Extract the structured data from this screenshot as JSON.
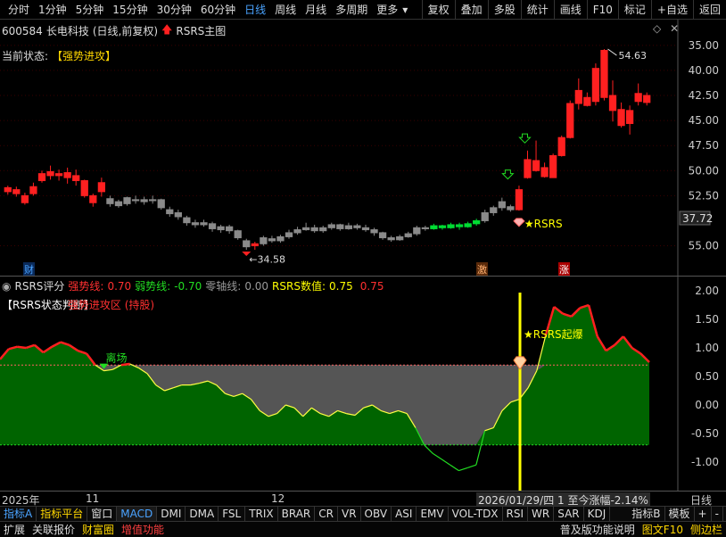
{
  "toolbar": {
    "periods": [
      "分时",
      "1分钟",
      "5分钟",
      "15分钟",
      "30分钟",
      "60分钟",
      "日线",
      "周线",
      "月线",
      "多周期",
      "更多"
    ],
    "active_period": "日线",
    "right_items": [
      "复权",
      "叠加",
      "多股",
      "统计",
      "画线",
      "F10",
      "标记",
      "+自选",
      "返回"
    ]
  },
  "main": {
    "code": "600584",
    "name": "长电科技",
    "mode": "(日线,前复权)",
    "indicator": "RSRS主图",
    "status_label": "当前状态:",
    "status_value": "【强势进攻】",
    "high_label": "54.63",
    "low_label": "34.58",
    "last_price": "37.72",
    "rsrs_tag": "RSRS",
    "markers": [
      "财",
      "激",
      "涨"
    ],
    "y_ticks": [
      "55.00",
      "52.50",
      "50.00",
      "47.50",
      "45.00",
      "42.50",
      "40.00",
      "35.00"
    ]
  },
  "indicator": {
    "name": "RSRS评分",
    "strong_label": "强势线:",
    "strong_value": "0.70",
    "weak_label": "弱势线:",
    "weak_value": "-0.70",
    "zero_label": "零轴线:",
    "zero_value": "0.00",
    "rsrs_label": "RSRS数值:",
    "rsrs_value": "0.75",
    "extra_value": "0.75",
    "state_title": "【RSRS状态判断】",
    "state_value": "强势进攻区 (持股)",
    "exit_label": "离场",
    "burst_label": "RSRS起爆",
    "y_ticks": [
      "2.00",
      "1.50",
      "1.00",
      "0.50",
      "0.00",
      "-0.50",
      "-1.00"
    ]
  },
  "dates": {
    "year": "2025年",
    "m11": "11",
    "m12": "12",
    "cursor_info": "2026/01/29/四 1 至今涨幅-2.14%",
    "period": "日线"
  },
  "tabs": [
    "指标A",
    "指标平台",
    "窗口",
    "MACD",
    "DMI",
    "DMA",
    "FSL",
    "TRIX",
    "BRAR",
    "CR",
    "VR",
    "OBV",
    "ASI",
    "EMV",
    "VOL-TDX",
    "RSI",
    "WR",
    "SAR",
    "KDJ",
    "指标B",
    "模板",
    "+",
    "-"
  ],
  "statusbar": {
    "left": [
      "扩展",
      "关联报价",
      "财富圈",
      "增值功能"
    ],
    "right": [
      "普及版功能说明",
      "图文F10",
      "侧边栏"
    ]
  },
  "colors": {
    "up": "#ff2020",
    "down": "#00cc44",
    "neutral": "#888888",
    "fill_green": "#006400",
    "yellow": "#ffff00",
    "accent_blue": "#4aa3ff"
  },
  "chart_data": [
    {
      "type": "candlestick",
      "title": "RSRS主图",
      "ylim": [
        33,
        56.5
      ],
      "y_ticks": [
        35,
        40,
        42.5,
        45,
        47.5,
        50,
        52.5,
        55
      ],
      "candles": [
        [
          40.8,
          40.4,
          41.0,
          40.1,
          "r"
        ],
        [
          40.2,
          40.6,
          40.9,
          39.9,
          "r"
        ],
        [
          40.0,
          39.3,
          40.3,
          39.1,
          "r"
        ],
        [
          40.2,
          40.9,
          41.3,
          40.0,
          "r"
        ],
        [
          41.5,
          42.2,
          42.5,
          41.3,
          "r"
        ],
        [
          42.4,
          42.0,
          43.0,
          41.6,
          "r"
        ],
        [
          42.0,
          42.2,
          42.6,
          41.5,
          "r"
        ],
        [
          41.8,
          42.3,
          42.8,
          41.2,
          "r"
        ],
        [
          42.0,
          41.5,
          42.6,
          41.0,
          "r"
        ],
        [
          41.5,
          40.0,
          41.6,
          39.8,
          "r"
        ],
        [
          40.0,
          39.3,
          40.2,
          38.9,
          "r"
        ],
        [
          40.4,
          41.3,
          41.8,
          39.9,
          "r"
        ],
        [
          39.2,
          39.7,
          40.0,
          38.9,
          "g"
        ],
        [
          39.0,
          39.4,
          39.6,
          38.8,
          "g"
        ],
        [
          39.2,
          39.8,
          39.9,
          39.0,
          "g"
        ],
        [
          39.5,
          39.6,
          40.0,
          39.2,
          "g"
        ],
        [
          39.6,
          39.4,
          39.9,
          39.1,
          "g"
        ],
        [
          39.5,
          39.6,
          40.0,
          39.2,
          "g"
        ],
        [
          39.6,
          38.8,
          39.7,
          38.6,
          "g"
        ],
        [
          38.6,
          38.2,
          38.9,
          37.9,
          "g"
        ],
        [
          38.3,
          37.9,
          38.6,
          37.6,
          "g"
        ],
        [
          37.8,
          37.3,
          38.0,
          37.0,
          "g"
        ],
        [
          37.3,
          37.1,
          37.6,
          36.8,
          "g"
        ],
        [
          37.1,
          37.3,
          37.6,
          36.9,
          "g"
        ],
        [
          37.2,
          36.7,
          37.4,
          36.4,
          "g"
        ],
        [
          36.6,
          36.9,
          37.1,
          36.3,
          "g"
        ],
        [
          36.9,
          36.5,
          37.1,
          36.2,
          "g"
        ],
        [
          36.5,
          35.8,
          36.6,
          35.6,
          "g"
        ],
        [
          35.5,
          34.9,
          35.7,
          34.6,
          "g"
        ],
        [
          35.0,
          35.2,
          35.4,
          34.6,
          "r"
        ],
        [
          35.2,
          35.8,
          36.0,
          35.0,
          "g"
        ],
        [
          35.7,
          35.5,
          36.0,
          35.3,
          "g"
        ],
        [
          35.5,
          35.9,
          36.1,
          35.3,
          "g"
        ],
        [
          35.9,
          36.3,
          36.6,
          35.7,
          "g"
        ],
        [
          36.3,
          36.6,
          36.9,
          36.1,
          "g"
        ],
        [
          36.6,
          36.8,
          37.3,
          36.5,
          "g"
        ],
        [
          36.8,
          36.5,
          37.1,
          36.3,
          "g"
        ],
        [
          36.5,
          36.8,
          37.0,
          36.3,
          "g"
        ],
        [
          36.8,
          37.1,
          37.3,
          36.6,
          "g"
        ],
        [
          37.1,
          36.7,
          37.2,
          36.5,
          "g"
        ],
        [
          36.7,
          37.0,
          37.3,
          36.6,
          "g"
        ],
        [
          37.0,
          36.8,
          37.2,
          36.6,
          "g"
        ],
        [
          36.8,
          36.6,
          37.1,
          36.4,
          "g"
        ],
        [
          36.6,
          36.3,
          36.8,
          36.0,
          "g"
        ],
        [
          36.3,
          35.8,
          36.4,
          35.6,
          "g"
        ],
        [
          35.8,
          35.6,
          36.0,
          35.4,
          "g"
        ],
        [
          35.6,
          35.9,
          36.1,
          35.5,
          "g"
        ],
        [
          35.9,
          36.2,
          36.4,
          35.8,
          "g"
        ],
        [
          36.2,
          36.8,
          37.0,
          36.0,
          "g"
        ],
        [
          36.8,
          36.7,
          37.0,
          36.5,
          "g"
        ],
        [
          36.7,
          37.0,
          37.2,
          36.6,
          "gg"
        ],
        [
          37.0,
          36.8,
          37.1,
          36.6,
          "gg"
        ],
        [
          36.8,
          37.1,
          37.3,
          36.7,
          "gg"
        ],
        [
          37.1,
          36.9,
          37.3,
          36.6,
          "gg"
        ],
        [
          36.9,
          37.2,
          37.4,
          36.8,
          "gg"
        ],
        [
          37.2,
          37.5,
          37.7,
          37.0,
          "gg"
        ],
        [
          37.5,
          38.3,
          38.6,
          37.3,
          "g"
        ],
        [
          38.3,
          38.8,
          39.0,
          38.0,
          "g"
        ],
        [
          38.8,
          39.4,
          39.8,
          38.5,
          "g"
        ],
        [
          38.9,
          38.6,
          39.1,
          38.4,
          "g"
        ],
        [
          38.6,
          40.6,
          41.0,
          38.5,
          "r"
        ],
        [
          41.8,
          43.6,
          44.5,
          41.7,
          "r"
        ],
        [
          42.5,
          43.5,
          45.5,
          42.4,
          "r"
        ],
        [
          42.8,
          41.9,
          43.3,
          41.8,
          "r"
        ],
        [
          41.8,
          44.0,
          44.2,
          41.8,
          "r"
        ],
        [
          44.0,
          45.8,
          46.0,
          43.9,
          "r"
        ],
        [
          45.8,
          49.2,
          49.5,
          45.7,
          "r"
        ],
        [
          49.2,
          50.5,
          51.7,
          48.6,
          "r"
        ],
        [
          49.0,
          49.8,
          50.3,
          48.9,
          "r"
        ],
        [
          49.4,
          52.7,
          53.2,
          49.0,
          "r"
        ],
        [
          49.8,
          54.5,
          54.63,
          49.5,
          "r"
        ],
        [
          50.0,
          48.5,
          51.5,
          47.4,
          "r"
        ],
        [
          48.6,
          47.0,
          49.3,
          46.8,
          "r"
        ],
        [
          47.2,
          48.5,
          49.0,
          46.1,
          "r"
        ],
        [
          49.4,
          50.2,
          51.2,
          49.0,
          "r"
        ],
        [
          50.0,
          49.3,
          50.3,
          49.0,
          "r"
        ]
      ]
    },
    {
      "type": "area",
      "title": "RSRS评分",
      "ylim": [
        -1.5,
        2.25
      ],
      "y_ticks": [
        -1.0,
        -0.5,
        0,
        0.5,
        1.0,
        1.5,
        2.0
      ],
      "strong_line": 0.7,
      "weak_line": -0.7,
      "values": [
        0.8,
        0.98,
        1.02,
        1.0,
        1.05,
        0.92,
        1.02,
        1.1,
        1.05,
        0.95,
        0.9,
        0.7,
        0.6,
        0.62,
        0.7,
        0.72,
        0.65,
        0.55,
        0.35,
        0.25,
        0.3,
        0.35,
        0.35,
        0.38,
        0.42,
        0.35,
        0.2,
        0.15,
        0.2,
        0.1,
        -0.1,
        -0.2,
        -0.15,
        0.0,
        -0.05,
        -0.2,
        -0.05,
        -0.15,
        -0.2,
        -0.1,
        -0.15,
        -0.18,
        -0.05,
        0.0,
        -0.1,
        -0.15,
        -0.1,
        -0.15,
        -0.4,
        -0.7,
        -0.85,
        -0.95,
        -1.05,
        -1.15,
        -1.1,
        -1.05,
        -0.45,
        -0.4,
        -0.1,
        0.05,
        0.1,
        0.3,
        0.6,
        1.2,
        1.72,
        1.6,
        1.55,
        1.7,
        1.75,
        1.2,
        0.95,
        1.05,
        1.2,
        1.0,
        0.9,
        0.75
      ]
    }
  ]
}
